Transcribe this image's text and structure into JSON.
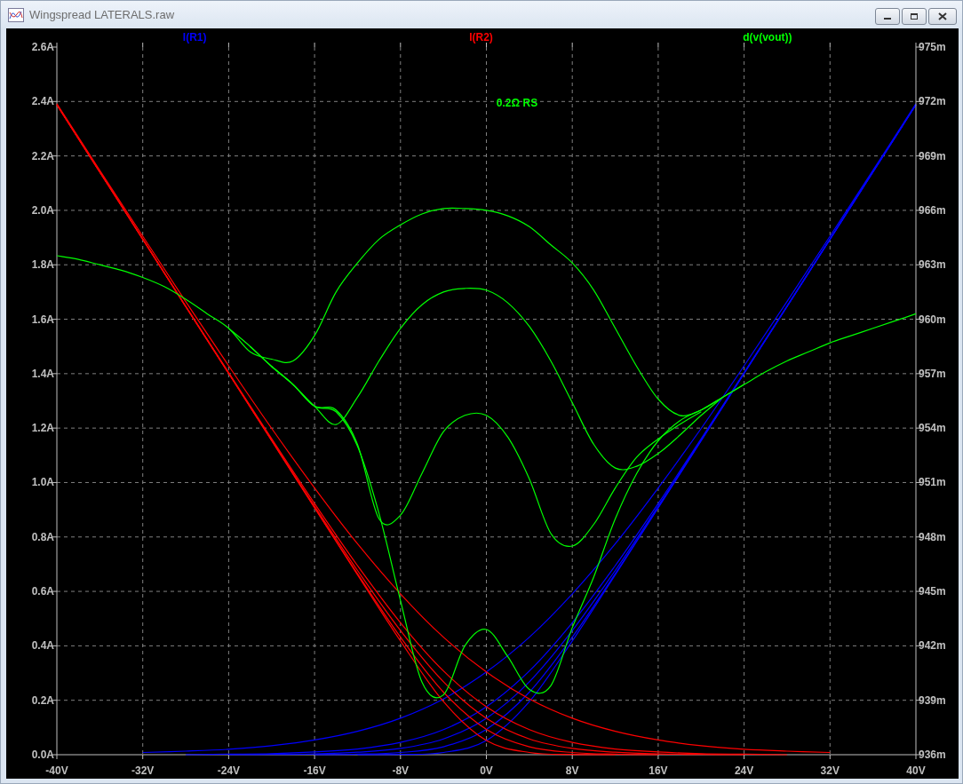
{
  "window": {
    "title": "Wingspread LATERALS.raw"
  },
  "plot": {
    "traces": [
      {
        "label": "I(R1)",
        "color": "#0000ff"
      },
      {
        "label": "I(R2)",
        "color": "#ff0000"
      },
      {
        "label": "d(v(vout))",
        "color": "#00ff00"
      }
    ],
    "annotation": "0.2Ω RS",
    "chart_data": {
      "type": "line",
      "grid": true,
      "x": [
        -40,
        -36,
        -32,
        -28,
        -24,
        -20,
        -16,
        -12,
        -8,
        -4,
        0,
        4,
        8,
        12,
        16,
        20,
        24,
        28,
        32,
        36,
        40
      ],
      "xlim": [
        -40,
        40
      ],
      "ylim": [
        0,
        2.6
      ],
      "xticks": [
        {
          "value": -40,
          "label": "-40V"
        },
        {
          "value": -32,
          "label": "-32V"
        },
        {
          "value": -24,
          "label": "-24V"
        },
        {
          "value": -16,
          "label": "-16V"
        },
        {
          "value": -8,
          "label": "-8V"
        },
        {
          "value": 0,
          "label": "0V"
        },
        {
          "value": 8,
          "label": "8V"
        },
        {
          "value": 16,
          "label": "16V"
        },
        {
          "value": 24,
          "label": "24V"
        },
        {
          "value": 32,
          "label": "32V"
        },
        {
          "value": 40,
          "label": "40V"
        }
      ],
      "yticks": [
        {
          "value": 0,
          "label": "0.0A"
        },
        {
          "value": 0.2,
          "label": "0.2A"
        },
        {
          "value": 0.4,
          "label": "0.4A"
        },
        {
          "value": 0.6,
          "label": "0.6A"
        },
        {
          "value": 0.8,
          "label": "0.8A"
        },
        {
          "value": 1.0,
          "label": "1.0A"
        },
        {
          "value": 1.2,
          "label": "1.2A"
        },
        {
          "value": 1.4,
          "label": "1.4A"
        },
        {
          "value": 1.6,
          "label": "1.6A"
        },
        {
          "value": 1.8,
          "label": "1.8A"
        },
        {
          "value": 2.0,
          "label": "2.0A"
        },
        {
          "value": 2.2,
          "label": "2.2A"
        },
        {
          "value": 2.4,
          "label": "2.4A"
        },
        {
          "value": 2.6,
          "label": "2.6A"
        }
      ],
      "series": [
        {
          "color": "#0000ff",
          "values": [
            null,
            null,
            null,
            null,
            null,
            null,
            null,
            0,
            0.001,
            0.008,
            0.052,
            0.195,
            0.418,
            0.661,
            0.907,
            1.154,
            1.401,
            1.647,
            1.894,
            2.141,
            2.388
          ]
        },
        {
          "color": "#0000ff",
          "values": [
            null,
            null,
            null,
            null,
            null,
            null,
            0,
            0.002,
            0.008,
            0.029,
            0.093,
            0.23,
            0.432,
            0.665,
            0.908,
            1.154,
            1.401,
            1.647,
            1.894,
            2.141,
            2.388
          ]
        },
        {
          "color": "#0000ff",
          "values": [
            null,
            null,
            null,
            null,
            0,
            0.001,
            0.003,
            0.009,
            0.023,
            0.058,
            0.134,
            0.268,
            0.456,
            0.677,
            0.913,
            1.156,
            1.401,
            1.647,
            1.894,
            2.141,
            2.388
          ]
        },
        {
          "color": "#0000ff",
          "values": [
            null,
            null,
            null,
            0,
            0.002,
            0.004,
            0.01,
            0.021,
            0.045,
            0.092,
            0.176,
            0.308,
            0.485,
            0.695,
            0.923,
            1.161,
            1.404,
            1.648,
            1.894,
            2.141,
            2.388
          ]
        },
        {
          "color": "#0000ff",
          "values": [
            null,
            null,
            0.008,
            0.013,
            0.02,
            0.033,
            0.054,
            0.086,
            0.134,
            0.205,
            0.304,
            0.432,
            0.591,
            0.775,
            0.98,
            1.199,
            1.429,
            1.665,
            1.905,
            2.147,
            2.392
          ]
        },
        {
          "color": "#ff0000",
          "values": [
            2.388,
            2.141,
            1.894,
            1.647,
            1.401,
            1.154,
            0.907,
            0.661,
            0.418,
            0.195,
            0.052,
            0.008,
            0.001,
            0,
            null,
            null,
            null,
            null,
            null,
            null,
            null
          ]
        },
        {
          "color": "#ff0000",
          "values": [
            2.388,
            2.141,
            1.894,
            1.647,
            1.401,
            1.154,
            0.908,
            0.665,
            0.432,
            0.23,
            0.093,
            0.029,
            0.008,
            0.002,
            0,
            null,
            null,
            null,
            null,
            null,
            null
          ]
        },
        {
          "color": "#ff0000",
          "values": [
            2.388,
            2.141,
            1.894,
            1.647,
            1.401,
            1.156,
            0.913,
            0.677,
            0.456,
            0.268,
            0.134,
            0.058,
            0.023,
            0.009,
            0.003,
            0.001,
            0,
            null,
            null,
            null,
            null
          ]
        },
        {
          "color": "#ff0000",
          "values": [
            2.388,
            2.141,
            1.894,
            1.648,
            1.404,
            1.161,
            0.923,
            0.695,
            0.485,
            0.308,
            0.176,
            0.092,
            0.045,
            0.021,
            0.01,
            0.004,
            0.002,
            0,
            null,
            null,
            null
          ]
        },
        {
          "color": "#ff0000",
          "values": [
            2.392,
            2.147,
            1.905,
            1.665,
            1.429,
            1.199,
            0.98,
            0.775,
            0.591,
            0.432,
            0.304,
            0.205,
            0.134,
            0.086,
            0.054,
            0.033,
            0.02,
            0.013,
            0.008,
            null,
            null
          ]
        }
      ]
    },
    "derivative_chart": {
      "chart_data": {
        "type": "line",
        "x": [
          -40,
          -38,
          -36,
          -34,
          -32,
          -30,
          -28,
          -26,
          -24,
          -22,
          -20,
          -18,
          -16,
          -14,
          -12,
          -10,
          -8,
          -6,
          -4,
          -2,
          0,
          2,
          4,
          6,
          8,
          10,
          12,
          14,
          16,
          18,
          20,
          22,
          24,
          26,
          28,
          30,
          32,
          34,
          36,
          38,
          40
        ],
        "xlim": [
          -40,
          40
        ],
        "ylim": [
          936,
          975
        ],
        "yticks": [
          {
            "value": 936,
            "label": "936m"
          },
          {
            "value": 939,
            "label": "939m"
          },
          {
            "value": 942,
            "label": "942m"
          },
          {
            "value": 945,
            "label": "945m"
          },
          {
            "value": 948,
            "label": "948m"
          },
          {
            "value": 951,
            "label": "951m"
          },
          {
            "value": 954,
            "label": "954m"
          },
          {
            "value": 957,
            "label": "957m"
          },
          {
            "value": 960,
            "label": "960m"
          },
          {
            "value": 963,
            "label": "963m"
          },
          {
            "value": 966,
            "label": "966m"
          },
          {
            "value": 969,
            "label": "969m"
          },
          {
            "value": 972,
            "label": "972m"
          },
          {
            "value": 975,
            "label": "975m"
          }
        ],
        "series": [
          {
            "color": "#00ff00",
            "values": [
              963.5,
              963.3,
              963.0,
              962.7,
              962.3,
              961.8,
              961.1,
              960.3,
              959.5,
              958.2,
              957.8,
              957.7,
              959.1,
              961.5,
              963.1,
              964.4,
              965.2,
              965.8,
              966.1,
              966.1,
              966.0,
              965.7,
              965.1,
              964.1,
              963.1,
              961.6,
              959.5,
              957.4,
              955.6,
              954.7,
              955.0,
              955.7,
              956.4,
              957.1,
              957.7,
              958.2,
              958.7,
              959.1,
              959.5,
              959.9,
              960.3
            ]
          },
          {
            "color": "#00ff00",
            "values": [
              null,
              null,
              null,
              null,
              null,
              null,
              null,
              null,
              959.5,
              958.5,
              957.4,
              956.4,
              955.2,
              954.2,
              955.7,
              957.7,
              959.5,
              960.8,
              961.5,
              961.7,
              961.6,
              960.9,
              959.6,
              957.7,
              955.4,
              953.1,
              951.8,
              951.9,
              952.6,
              953.6,
              954.7,
              955.7,
              null,
              null,
              null,
              null,
              null,
              null,
              null,
              null,
              null
            ]
          },
          {
            "color": "#00ff00",
            "values": [
              null,
              null,
              null,
              null,
              null,
              null,
              null,
              null,
              null,
              958.5,
              957.4,
              956.4,
              955.2,
              955.0,
              953.1,
              949.0,
              949.2,
              951.5,
              953.8,
              954.7,
              954.7,
              953.5,
              951.2,
              948.2,
              947.5,
              948.7,
              950.7,
              952.4,
              953.4,
              954.2,
              954.9,
              null,
              null,
              null,
              null,
              null,
              null,
              null,
              null,
              null,
              null
            ]
          },
          {
            "color": "#00ff00",
            "values": [
              null,
              null,
              null,
              null,
              null,
              null,
              null,
              null,
              null,
              null,
              957.4,
              956.4,
              955.2,
              954.9,
              953.0,
              949.3,
              944.5,
              940.0,
              939.3,
              942.0,
              942.9,
              941.4,
              939.6,
              939.8,
              943.0,
              945.8,
              949.0,
              951.5,
              953.3,
              954.4,
              955.0,
              955.7,
              956.4,
              null,
              null,
              null,
              null,
              null,
              null,
              null,
              null
            ]
          }
        ]
      }
    }
  }
}
